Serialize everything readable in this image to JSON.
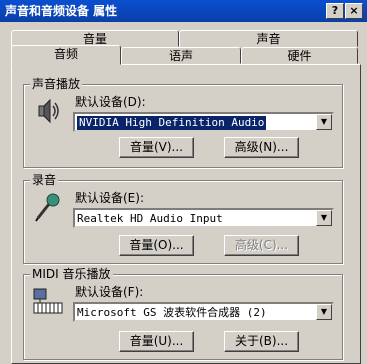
{
  "window": {
    "title": "声音和音频设备 属性",
    "help_label": "?",
    "close_label": "×"
  },
  "tabs": {
    "row1": [
      "音量",
      "声音"
    ],
    "row2": [
      "音频",
      "语声",
      "硬件"
    ],
    "active": "音频"
  },
  "playback": {
    "group_label": "声音播放",
    "device_label": "默认设备(D):",
    "device_value": "NVIDIA High Definition Audio",
    "volume_button": "音量(V)...",
    "advanced_button": "高级(N)...",
    "icon": "speaker-icon"
  },
  "recording": {
    "group_label": "录音",
    "device_label": "默认设备(E):",
    "device_value": "Realtek HD Audio Input",
    "volume_button": "音量(O)...",
    "advanced_button": "高级(C)...",
    "icon": "microphone-icon"
  },
  "midi": {
    "group_label": "MIDI 音乐播放",
    "device_label": "默认设备(F):",
    "device_value": "Microsoft GS 波表软件合成器 (2)",
    "volume_button": "音量(U)...",
    "about_button": "关于(B)...",
    "icon": "midi-keyboard-icon"
  },
  "colors": {
    "title_bar": "#0a3fa8",
    "face": "#d4d0c8",
    "selection": "#0a246a"
  }
}
